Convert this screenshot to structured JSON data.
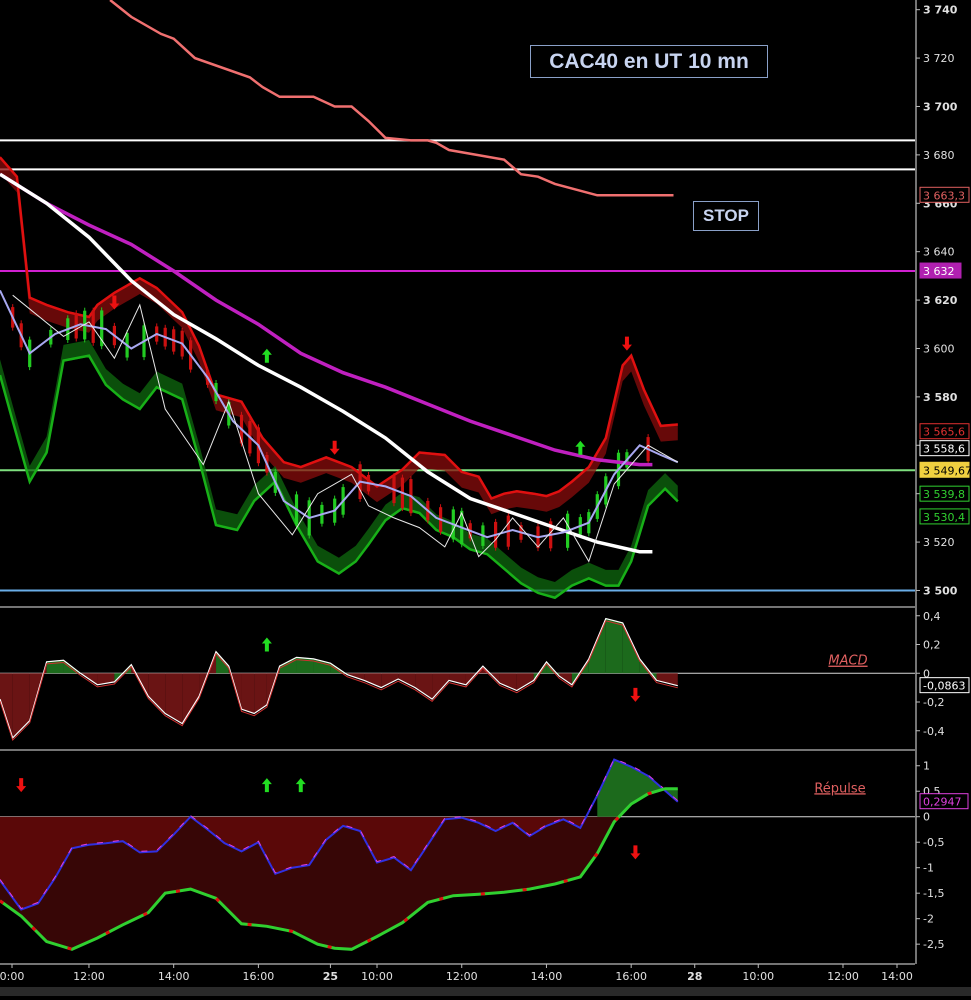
{
  "title": "CAC40 en UT 10 mn",
  "stop_label": "STOP",
  "colors": {
    "background": "#000000",
    "up_candle": "#22cc22",
    "down_candle": "#cc1111",
    "upper_band": "#e01010",
    "lower_band": "#18b018",
    "ma_white": "#ffffff",
    "ma_magenta": "#c020c0",
    "stop_line": "#f07070",
    "ma_fast": "#a8a8f0"
  },
  "x_axis": {
    "ticks": [
      "0:00",
      "12:00",
      "14:00",
      "16:00",
      "25",
      "10:00",
      "12:00",
      "14:00",
      "16:00",
      "28",
      "10:00",
      "12:00",
      "14:00"
    ]
  },
  "main_panel": {
    "y_ticks": [
      "3 740",
      "3 720",
      "3 700",
      "3 680",
      "3 660",
      "3 640",
      "3 620",
      "3 600",
      "3 580",
      "3 560",
      "3 540",
      "3 520",
      "3 500"
    ],
    "y_range": [
      3494,
      3744
    ],
    "horizontal_lines": [
      {
        "value": 3686,
        "color": "#ffffff"
      },
      {
        "value": 3674,
        "color": "#ffffff"
      },
      {
        "value": 3632,
        "color": "#d020d0"
      },
      {
        "value": 3549.67,
        "color": "#7fe07f"
      },
      {
        "value": 3500,
        "color": "#6aaee8"
      }
    ],
    "value_badges": [
      {
        "label": "3 663,3",
        "value": 3663.3,
        "color": "#e06060",
        "bg": "#000000"
      },
      {
        "label": "3 632",
        "value": 3632,
        "color": "#ffffff",
        "bg": "#b020b0"
      },
      {
        "label": "3 565,6",
        "value": 3565.6,
        "color": "#e03030",
        "bg": "#000000"
      },
      {
        "label": "3 558,6",
        "value": 3558.6,
        "color": "#ffffff",
        "bg": "#000000"
      },
      {
        "label": "3 549,67",
        "value": 3549.67,
        "color": "#000000",
        "bg": "#f0d040"
      },
      {
        "label": "3 539,8",
        "value": 3539.8,
        "color": "#30d030",
        "bg": "#000000"
      },
      {
        "label": "3 530,4",
        "value": 3530.4,
        "color": "#30d030",
        "bg": "#000000"
      }
    ],
    "arrows": [
      {
        "x": 12.6,
        "y": 3619,
        "dir": "down"
      },
      {
        "x": 16.2,
        "y": 3597,
        "dir": "up"
      },
      {
        "x": 17.8,
        "y": 3559,
        "dir": "down"
      },
      {
        "x": 23.6,
        "y": 3559,
        "dir": "up"
      },
      {
        "x": 24.7,
        "y": 3602,
        "dir": "down"
      }
    ]
  },
  "macd_panel": {
    "label": "MACD",
    "y_ticks": [
      "0,4",
      "0,2",
      "0",
      "-0,2",
      "-0,4"
    ],
    "y_range": [
      -0.52,
      0.44
    ],
    "badges": [
      {
        "label": "-0,0863",
        "value": -0.0863
      }
    ],
    "arrows": [
      {
        "x": 16.2,
        "y": 0.2,
        "dir": "up"
      },
      {
        "x": 24.9,
        "y": -0.15,
        "dir": "down"
      }
    ]
  },
  "repulse_panel": {
    "label": "Répulse",
    "y_ticks": [
      "1",
      "0,5",
      "0",
      "-0,5",
      "-1",
      "-1,5",
      "-2",
      "-2,5"
    ],
    "y_range": [
      -2.85,
      1.25
    ],
    "badges": [
      {
        "label": "0,2947",
        "value": 0.2947
      }
    ],
    "arrows": [
      {
        "x": 10.4,
        "y": 0.62,
        "dir": "down"
      },
      {
        "x": 16.2,
        "y": 0.62,
        "dir": "up"
      },
      {
        "x": 17.0,
        "y": 0.62,
        "dir": "up"
      },
      {
        "x": 24.9,
        "y": -0.7,
        "dir": "down"
      }
    ]
  },
  "chart_data": {
    "type": "line",
    "title": "CAC40 en UT 10 mn",
    "x_unit": "hours (session timeline)",
    "x_ticks": [
      "0:00",
      "12:00",
      "14:00",
      "16:00",
      "25",
      "10:00",
      "12:00",
      "14:00",
      "16:00",
      "28",
      "10:00",
      "12:00",
      "14:00"
    ],
    "xlim": [
      9.9,
      31.5
    ],
    "main": {
      "ylim": [
        3494,
        3744
      ],
      "series": [
        {
          "name": "stop_line",
          "x": [
            12.5,
            13.0,
            13.7,
            14.0,
            14.5,
            15.8,
            16.1,
            16.5,
            17.3,
            17.8,
            18.2,
            18.6,
            19.0,
            19.6,
            20.0,
            20.2,
            20.5,
            21.8,
            22.2,
            22.6,
            23.0,
            24.0,
            25.3,
            25.8
          ],
          "y": [
            3744,
            3737,
            3730,
            3728,
            3720,
            3712,
            3708,
            3704,
            3704,
            3700,
            3700,
            3694,
            3687,
            3686,
            3686,
            3685,
            3682,
            3678,
            3672,
            3671,
            3668,
            3663.3,
            3663.3,
            3663.3
          ]
        },
        {
          "name": "ma_white",
          "x": [
            9.9,
            11,
            12,
            13,
            14,
            15,
            16,
            17,
            18,
            19,
            20,
            21,
            22,
            23,
            24,
            25,
            25.3
          ],
          "y": [
            3672,
            3660,
            3646,
            3628,
            3614,
            3604,
            3593,
            3584,
            3574,
            3563,
            3549,
            3538,
            3532,
            3526,
            3520,
            3516,
            3516
          ]
        },
        {
          "name": "ma_magenta",
          "x": [
            9.9,
            11,
            12,
            13,
            14,
            15,
            16,
            17,
            18,
            19,
            20,
            21,
            22,
            23,
            24,
            25,
            25.3
          ],
          "y": [
            3672,
            3660,
            3651,
            3643,
            3632,
            3620,
            3610,
            3598,
            3590,
            3584,
            3577,
            3570,
            3564,
            3558,
            3554,
            3552,
            3552
          ]
        },
        {
          "name": "upper_band",
          "x": [
            9.9,
            10.3,
            10.6,
            11,
            11.5,
            12,
            12.2,
            12.6,
            13.2,
            13.6,
            14.2,
            14.6,
            15,
            15.6,
            16.1,
            16.6,
            17,
            17.6,
            18.2,
            18.8,
            19.4,
            19.8,
            20.4,
            20.8,
            21.2,
            21.5,
            21.8,
            22.1,
            22.5,
            22.8,
            23.1,
            23.4,
            23.8,
            24.2,
            24.6,
            24.8,
            25.1,
            25.5,
            25.9
          ],
          "y": [
            3676,
            3668,
            3618,
            3615,
            3612,
            3610,
            3615,
            3620,
            3626,
            3622,
            3612,
            3598,
            3578,
            3575,
            3560,
            3550,
            3548,
            3552,
            3548,
            3540,
            3547,
            3554,
            3553,
            3546,
            3544,
            3535,
            3537,
            3538,
            3537,
            3536,
            3538,
            3542,
            3548,
            3560,
            3590,
            3594,
            3580,
            3565,
            3565.6
          ]
        },
        {
          "name": "lower_band",
          "x": [
            9.9,
            10.2,
            10.6,
            11,
            11.4,
            12,
            12.4,
            12.8,
            13.2,
            13.6,
            14.2,
            14.6,
            15,
            15.5,
            15.9,
            16.4,
            16.9,
            17.4,
            17.9,
            18.3,
            18.6,
            19,
            19.4,
            19.8,
            20.2,
            20.6,
            21,
            21.4,
            21.8,
            22.2,
            22.6,
            23,
            23.4,
            23.8,
            24.2,
            24.5,
            24.8,
            25.2,
            25.6,
            25.9
          ],
          "y": [
            3592,
            3573,
            3548,
            3560,
            3598,
            3600,
            3588,
            3582,
            3578,
            3587,
            3582,
            3557,
            3530,
            3528,
            3540,
            3548,
            3530,
            3515,
            3510,
            3515,
            3522,
            3532,
            3537,
            3535,
            3528,
            3525,
            3520,
            3518,
            3512,
            3506,
            3502,
            3500,
            3505,
            3508,
            3505,
            3505,
            3515,
            3538,
            3545,
            3539.8
          ]
        },
        {
          "name": "ma_fast",
          "x": [
            9.9,
            10.6,
            11.2,
            11.8,
            12.4,
            13,
            13.6,
            14.2,
            14.8,
            15.4,
            16,
            16.6,
            17.2,
            17.8,
            18.4,
            19,
            19.6,
            20.2,
            20.8,
            21.4,
            22,
            22.6,
            23.2,
            23.8,
            24.4,
            25,
            25.5,
            25.9
          ],
          "y": [
            3624,
            3598,
            3606,
            3610,
            3608,
            3600,
            3606,
            3602,
            3588,
            3570,
            3560,
            3537,
            3530,
            3533,
            3545,
            3543,
            3539,
            3530,
            3526,
            3522,
            3525,
            3522,
            3524,
            3528,
            3548,
            3560,
            3556,
            3553
          ]
        },
        {
          "name": "zigzag",
          "x": [
            10.2,
            11.4,
            12.0,
            12.6,
            13.2,
            13.8,
            14.7,
            15.3,
            16.0,
            16.8,
            17.4,
            18.2,
            18.6,
            19.2,
            19.8,
            20.4,
            20.8,
            21.2,
            21.6,
            22.0,
            22.6,
            23.2,
            23.8,
            24.4,
            25.2,
            25.9
          ],
          "y": [
            3622,
            3605,
            3611,
            3596,
            3618,
            3575,
            3552,
            3578,
            3540,
            3523,
            3540,
            3548,
            3535,
            3530,
            3526,
            3518,
            3532,
            3514,
            3521,
            3530,
            3518,
            3530,
            3512,
            3544,
            3560,
            3553
          ]
        },
        {
          "name": "candles_up_x",
          "x": [
            10.6,
            11.1,
            11.5,
            11.9,
            12.3,
            12.9,
            13.3,
            15.0,
            15.3,
            16.4,
            16.9,
            17.2,
            17.5,
            17.8,
            18.0,
            20.6,
            20.8,
            21.3,
            23.3,
            23.6,
            23.8,
            24.0,
            24.2,
            24.5,
            24.7
          ]
        },
        {
          "name": "candles_down_x",
          "x": [
            10.2,
            10.4,
            11.7,
            12.1,
            12.6,
            13.6,
            13.8,
            14.0,
            14.2,
            14.4,
            14.8,
            15.6,
            15.8,
            16.0,
            16.2,
            18.4,
            18.6,
            19.2,
            19.4,
            19.6,
            20.0,
            20.3,
            21.0,
            21.6,
            21.9,
            22.2,
            22.6,
            22.9,
            25.2
          ]
        }
      ]
    },
    "macd": {
      "ylim": [
        -0.52,
        0.44
      ],
      "series": [
        {
          "name": "MACD",
          "x": [
            9.9,
            10.2,
            10.6,
            11.0,
            11.4,
            11.8,
            12.2,
            12.6,
            13.0,
            13.4,
            13.8,
            14.2,
            14.6,
            15.0,
            15.3,
            15.6,
            15.9,
            16.2,
            16.5,
            16.9,
            17.3,
            17.7,
            18.1,
            18.5,
            18.9,
            19.3,
            19.7,
            20.1,
            20.5,
            20.9,
            21.3,
            21.7,
            22.1,
            22.5,
            22.8,
            23.1,
            23.4,
            23.8,
            24.2,
            24.6,
            25.0,
            25.4,
            25.9
          ],
          "y": [
            -0.18,
            -0.45,
            -0.33,
            0.08,
            0.09,
            0.0,
            -0.08,
            -0.06,
            0.06,
            -0.16,
            -0.28,
            -0.35,
            -0.16,
            0.15,
            0.05,
            -0.25,
            -0.28,
            -0.22,
            0.05,
            0.11,
            0.1,
            0.07,
            -0.01,
            -0.05,
            -0.1,
            -0.04,
            -0.1,
            -0.18,
            -0.05,
            -0.08,
            0.05,
            -0.07,
            -0.12,
            -0.05,
            0.08,
            -0.02,
            -0.08,
            0.1,
            0.38,
            0.35,
            0.1,
            -0.05,
            -0.0863
          ]
        }
      ]
    },
    "repulse": {
      "ylim": [
        -2.85,
        1.25
      ],
      "series": [
        {
          "name": "Répulse fast",
          "x": [
            9.9,
            10.4,
            10.8,
            11.2,
            11.6,
            12.0,
            12.4,
            12.8,
            13.2,
            13.6,
            14.0,
            14.4,
            14.8,
            15.2,
            15.6,
            16.0,
            16.4,
            16.8,
            17.2,
            17.6,
            18.0,
            18.4,
            18.8,
            19.2,
            19.6,
            20.0,
            20.4,
            20.8,
            21.2,
            21.6,
            22.0,
            22.4,
            22.8,
            23.2,
            23.6,
            24.0,
            24.4,
            24.8,
            25.2,
            25.9
          ],
          "y": [
            -1.25,
            -1.82,
            -1.7,
            -1.2,
            -0.62,
            -0.55,
            -0.52,
            -0.48,
            -0.7,
            -0.68,
            -0.35,
            0.0,
            -0.25,
            -0.52,
            -0.68,
            -0.5,
            -1.12,
            -1.0,
            -0.95,
            -0.45,
            -0.18,
            -0.28,
            -0.9,
            -0.8,
            -1.05,
            -0.55,
            -0.05,
            -0.02,
            -0.12,
            -0.28,
            -0.12,
            -0.38,
            -0.18,
            -0.05,
            -0.22,
            0.42,
            1.12,
            0.98,
            0.8,
            0.2947
          ]
        },
        {
          "name": "Répulse slow",
          "x": [
            9.9,
            10.4,
            11.0,
            11.6,
            12.2,
            12.8,
            13.4,
            13.8,
            14.4,
            15.0,
            15.6,
            16.2,
            16.8,
            17.4,
            17.8,
            18.2,
            18.8,
            19.4,
            20.0,
            20.6,
            21.2,
            21.8,
            22.4,
            23.0,
            23.6,
            24.0,
            24.4,
            24.8,
            25.2,
            25.6,
            25.9
          ],
          "y": [
            -1.65,
            -1.95,
            -2.45,
            -2.6,
            -2.38,
            -2.12,
            -1.88,
            -1.5,
            -1.42,
            -1.6,
            -2.1,
            -2.15,
            -2.25,
            -2.5,
            -2.58,
            -2.6,
            -2.35,
            -2.08,
            -1.68,
            -1.55,
            -1.52,
            -1.48,
            -1.42,
            -1.32,
            -1.18,
            -0.72,
            -0.1,
            0.25,
            0.45,
            0.55,
            0.55
          ]
        }
      ]
    }
  }
}
